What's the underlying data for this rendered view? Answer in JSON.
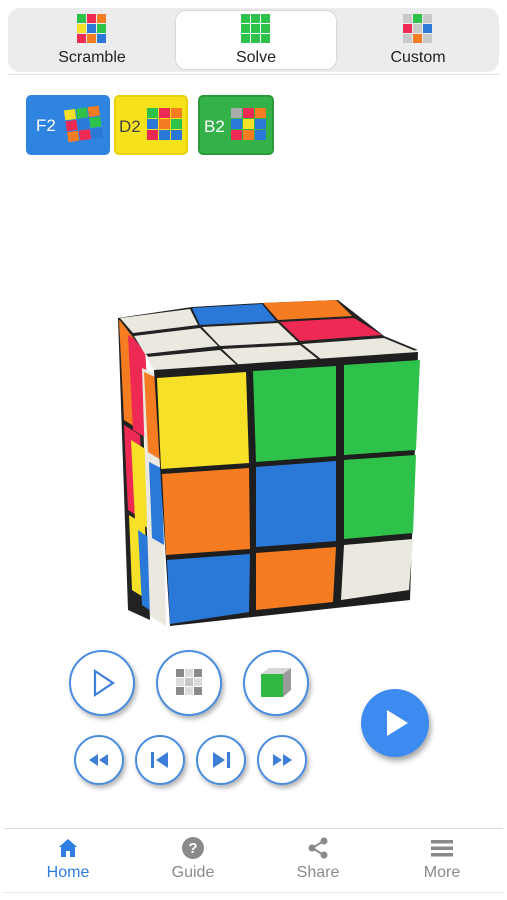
{
  "tabs": [
    {
      "label": "Scramble",
      "icon": "scramble-grid-icon"
    },
    {
      "label": "Solve",
      "icon": "solve-grid-icon",
      "active": true
    },
    {
      "label": "Custom",
      "icon": "custom-grid-icon"
    }
  ],
  "formulas": [
    {
      "label": "F2",
      "color": "#2f84e0"
    },
    {
      "label": "D2",
      "color": "#f6e21a"
    },
    {
      "label": "B2",
      "color": "#35b14a"
    }
  ],
  "nav": [
    {
      "label": "Home",
      "icon": "home-icon",
      "active": true
    },
    {
      "label": "Guide",
      "icon": "question-icon"
    },
    {
      "label": "Share",
      "icon": "share-icon"
    },
    {
      "label": "More",
      "icon": "menu-icon"
    }
  ],
  "colors": {
    "accent": "#3d8bf0",
    "cube_green": "#2fc24a",
    "cube_orange": "#f57c21",
    "cube_blue": "#2a78d8",
    "cube_yellow": "#f7e128",
    "cube_red": "#ee2a54",
    "cube_white": "#ebe9df"
  }
}
